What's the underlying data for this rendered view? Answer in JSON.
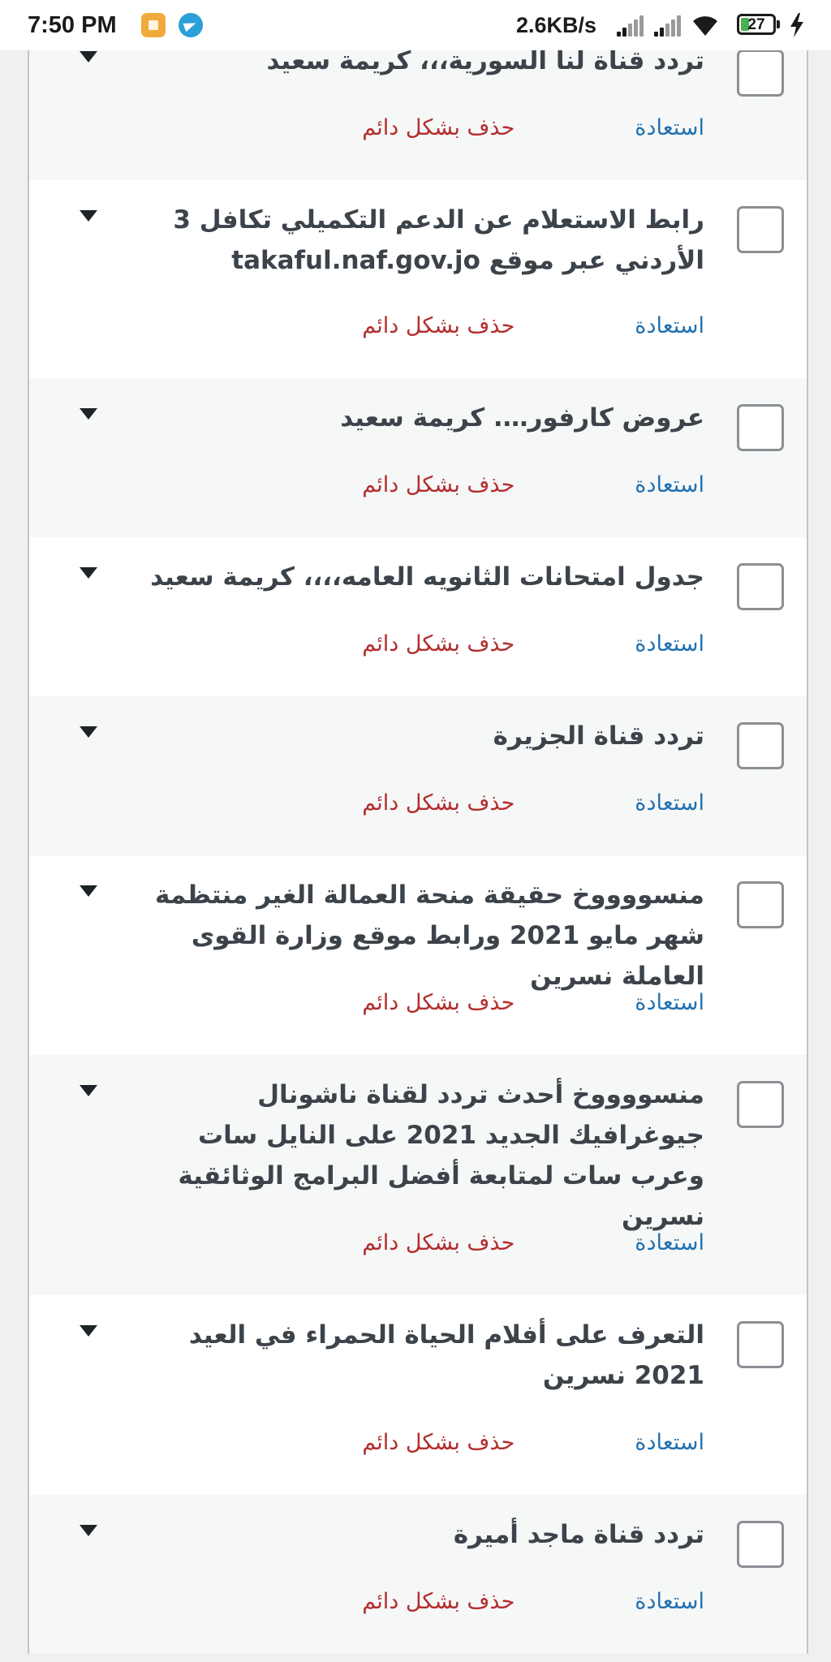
{
  "status_bar": {
    "time": "7:50 PM",
    "network_speed": "2.6KB/s",
    "battery_level": "27",
    "battery_fraction": 0.27,
    "icons": [
      "notes-app-icon",
      "telegram-icon",
      "signal-icon",
      "signal-icon",
      "wifi-icon",
      "battery-icon",
      "charging-icon"
    ]
  },
  "colors": {
    "restore_link": "#2271b1",
    "delete_link": "#b32d2e",
    "title_text": "#3c434a",
    "row_shaded": "#f6f7f7",
    "row_plain": "#ffffff"
  },
  "posts": [
    {
      "title": "تردد قناة لنا السورية،،، كريمة سعيد",
      "restore": "استعادة",
      "delete": "حذف بشكل دائم"
    },
    {
      "title": "رابط الاستعلام عن الدعم التكميلي تكافل 3 الأردني عبر موقع takaful.naf.gov.jo",
      "restore": "استعادة",
      "delete": "حذف بشكل دائم"
    },
    {
      "title": "عروض كارفور…. كريمة سعيد",
      "restore": "استعادة",
      "delete": "حذف بشكل دائم"
    },
    {
      "title": "جدول امتحانات الثانويه العامه،،،، كريمة سعيد",
      "restore": "استعادة",
      "delete": "حذف بشكل دائم"
    },
    {
      "title": "تردد قناة الجزيرة",
      "restore": "استعادة",
      "delete": "حذف بشكل دائم"
    },
    {
      "title": "منسووووخ حقيقة منحة العمالة الغير منتظمة شهر مايو 2021 ورابط موقع وزارة القوى العاملة نسرين",
      "restore": "استعادة",
      "delete": "حذف بشكل دائم"
    },
    {
      "title": "منسووووخ أحدث تردد لقناة ناشونال جيوغرافيك الجديد 2021 على النايل سات وعرب سات لمتابعة أفضل البرامج الوثائقية نسرين",
      "restore": "استعادة",
      "delete": "حذف بشكل دائم"
    },
    {
      "title": "التعرف على أفلام الحياة الحمراء في العيد 2021 نسرين",
      "restore": "استعادة",
      "delete": "حذف بشكل دائم"
    },
    {
      "title": "تردد قناة ماجد أميرة",
      "restore": "استعادة",
      "delete": "حذف بشكل دائم"
    }
  ]
}
